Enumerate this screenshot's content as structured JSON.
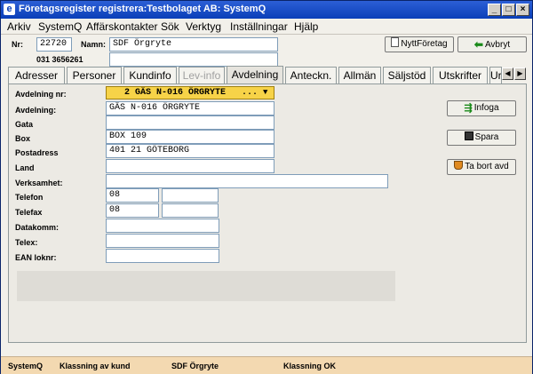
{
  "window": {
    "title": "Företagsregister registrera:Testbolaget AB: SystemQ",
    "icon_glyph": "e"
  },
  "menu": [
    "Arkiv",
    "SystemQ",
    "Affärskontakter",
    "Sök",
    "Verktyg",
    "Inställningar",
    "Hjälp"
  ],
  "header": {
    "nr_label": "Nr:",
    "nr_value": "22720",
    "namn_label": "Namn:",
    "namn_value": "SDF Örgryte",
    "phone": "031 3656261",
    "new_company_button": "NyttFöretag",
    "cancel_button": "Avbryt"
  },
  "tabs": [
    {
      "label": "Adresser",
      "state": "normal"
    },
    {
      "label": "Personer",
      "state": "normal"
    },
    {
      "label": "Kundinfo",
      "state": "normal"
    },
    {
      "label": "Lev-info",
      "state": "disabled"
    },
    {
      "label": "Avdelning",
      "state": "active"
    },
    {
      "label": "Anteckn.",
      "state": "normal"
    },
    {
      "label": "Allmän",
      "state": "normal"
    },
    {
      "label": "Säljstöd",
      "state": "normal"
    },
    {
      "label": "Utskrifter",
      "state": "normal"
    },
    {
      "label": "Ur",
      "state": "normal"
    }
  ],
  "form": {
    "avdelning_nr_label": "Avdelning nr:",
    "avdelning_nr_value": "2   GÄS N-016 ÖRGRYTE",
    "avdelning_nr_ellipsis": "...",
    "avdelning_label": "Avdelning:",
    "avdelning_value": "GÄS N-016 ÖRGRYTE",
    "gata_label": "Gata",
    "gata_value": "",
    "box_label": "Box",
    "box_value": "BOX 109",
    "postadress_label": "Postadress",
    "postadress_value": "401 21  GÖTEBORG",
    "land_label": "Land",
    "land_value": "",
    "verksamhet_label": "Verksamhet:",
    "verksamhet_value": "",
    "telefon_label": "Telefon",
    "telefon_value": "08",
    "telefon_value2": "",
    "telefax_label": "Telefax",
    "telefax_value": "08",
    "telefax_value2": "",
    "datakomm_label": "Datakomm:",
    "datakomm_value": "",
    "telex_label": "Telex:",
    "telex_value": "",
    "ean_label": "EAN loknr:",
    "ean_value": ""
  },
  "actions": {
    "infoga": "Infoga",
    "spara": "Spara",
    "ta_bort": "Ta bort avd"
  },
  "status": [
    "SystemQ",
    "Klassning av kund",
    "SDF Örgryte",
    "Klassning OK"
  ],
  "colors": {
    "dropdown_bg": "#f7d348",
    "status_bg": "#f3d9b1",
    "title_bg": "#0a3fb8"
  }
}
